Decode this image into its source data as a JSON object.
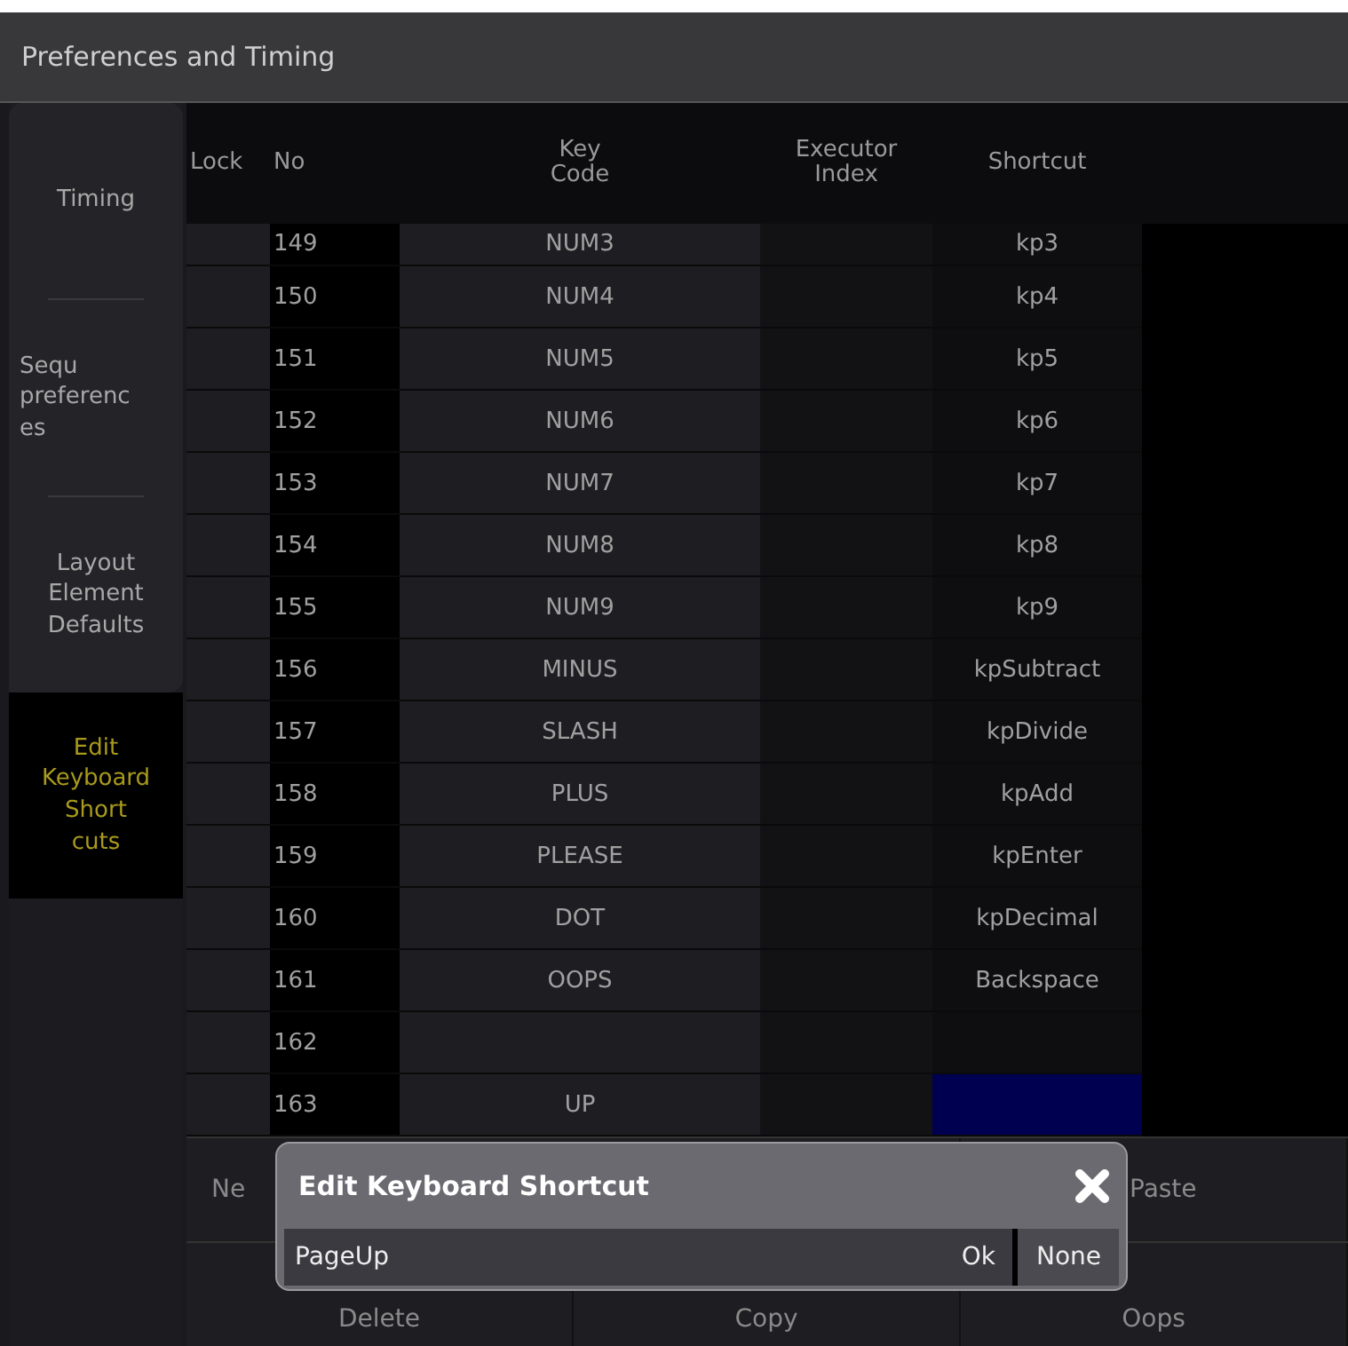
{
  "window": {
    "title": "Preferences and Timing"
  },
  "sidebar": {
    "items": [
      {
        "label": "Timing",
        "kind": "centered",
        "selected": false
      },
      {
        "label": "Sequ\npreferenc\nes",
        "kind": "left",
        "selected": false
      },
      {
        "label": "Layout\nElement\nDefaults",
        "kind": "centered",
        "selected": false
      },
      {
        "label": "Edit\nKeyboard\nShort\ncuts",
        "kind": "centered",
        "selected": true
      }
    ]
  },
  "table": {
    "columns": [
      "Lock",
      "No",
      "Key\nCode",
      "Executor\nIndex",
      "Shortcut"
    ],
    "rows": [
      {
        "no": "149",
        "key_code": "NUM3",
        "shortcut": "kp3",
        "selected": false,
        "partial": true
      },
      {
        "no": "150",
        "key_code": "NUM4",
        "shortcut": "kp4",
        "selected": false,
        "partial": false
      },
      {
        "no": "151",
        "key_code": "NUM5",
        "shortcut": "kp5",
        "selected": false,
        "partial": false
      },
      {
        "no": "152",
        "key_code": "NUM6",
        "shortcut": "kp6",
        "selected": false,
        "partial": false
      },
      {
        "no": "153",
        "key_code": "NUM7",
        "shortcut": "kp7",
        "selected": false,
        "partial": false
      },
      {
        "no": "154",
        "key_code": "NUM8",
        "shortcut": "kp8",
        "selected": false,
        "partial": false
      },
      {
        "no": "155",
        "key_code": "NUM9",
        "shortcut": "kp9",
        "selected": false,
        "partial": false
      },
      {
        "no": "156",
        "key_code": "MINUS",
        "shortcut": "kpSubtract",
        "selected": false,
        "partial": false
      },
      {
        "no": "157",
        "key_code": "SLASH",
        "shortcut": "kpDivide",
        "selected": false,
        "partial": false
      },
      {
        "no": "158",
        "key_code": "PLUS",
        "shortcut": "kpAdd",
        "selected": false,
        "partial": false
      },
      {
        "no": "159",
        "key_code": "PLEASE",
        "shortcut": "kpEnter",
        "selected": false,
        "partial": false
      },
      {
        "no": "160",
        "key_code": "DOT",
        "shortcut": "kpDecimal",
        "selected": false,
        "partial": false
      },
      {
        "no": "161",
        "key_code": "OOPS",
        "shortcut": "Backspace",
        "selected": false,
        "partial": false
      },
      {
        "no": "162",
        "selected": false,
        "partial": false
      },
      {
        "no": "163",
        "key_code": "UP",
        "selected": true,
        "partial": false
      }
    ]
  },
  "buttons": [
    [
      "Ne",
      "Paste"
    ],
    [
      "Delete",
      "Copy",
      "Oops"
    ]
  ],
  "dialog": {
    "title": "Edit Keyboard Shortcut",
    "value": "PageUp",
    "buttons": [
      "Ok",
      "None"
    ]
  }
}
